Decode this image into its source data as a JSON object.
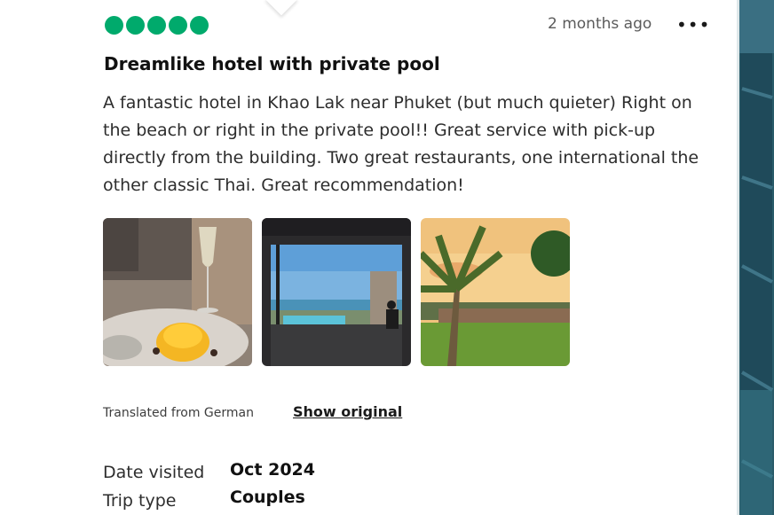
{
  "review": {
    "rating": 5,
    "bubbles": [
      1,
      1,
      1,
      1,
      1
    ],
    "rating_color": "#00aa6c",
    "time_ago": "2 months ago",
    "more_icon": "more-horizontal-icon",
    "title": "Dreamlike hotel with private pool",
    "body": "A fantastic hotel in Khao Lak near Phuket (but much quieter) Right on the beach or right in the private pool!! Great service with pick-up directly from the building. Two great restaurants, one international the other classic Thai. Great recommendation!",
    "translated_label": "Translated from German",
    "show_original_label": "Show original",
    "date_visited_label": "Date visited",
    "date_visited_value": "Oct 2024",
    "trip_type_label": "Trip type",
    "trip_type_value": "Couples"
  }
}
